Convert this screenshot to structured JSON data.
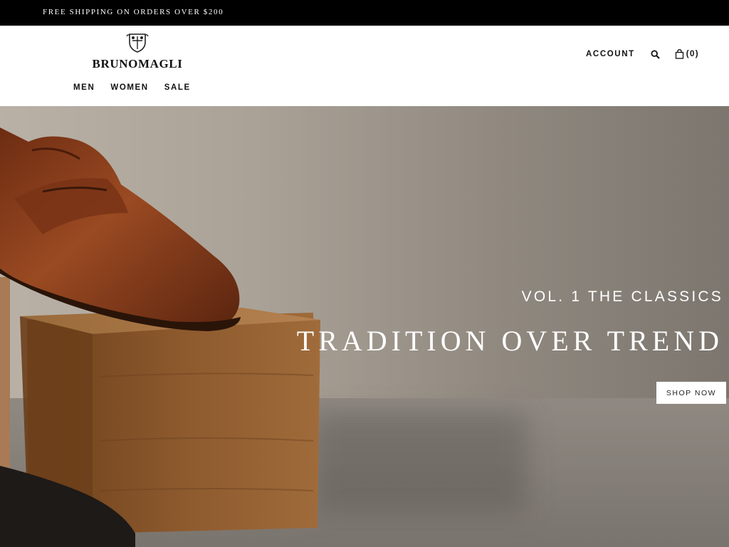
{
  "announcement": "FREE SHIPPING ON ORDERS OVER $200",
  "brand": {
    "name": "BRUNOMAGLI",
    "crest_icon": "crest-icon"
  },
  "nav": [
    "MEN",
    "WOMEN",
    "SALE"
  ],
  "utility": {
    "account": "ACCOUNT",
    "search_icon": "search-icon",
    "cart_icon": "bag-icon",
    "cart_count": "(0)"
  },
  "hero": {
    "eyebrow": "VOL. 1 THE CLASSICS",
    "headline": "TRADITION OVER TREND",
    "cta": "SHOP NOW"
  },
  "colors": {
    "announcement_bg": "#000000",
    "header_bg": "#ffffff",
    "text": "#111111"
  }
}
